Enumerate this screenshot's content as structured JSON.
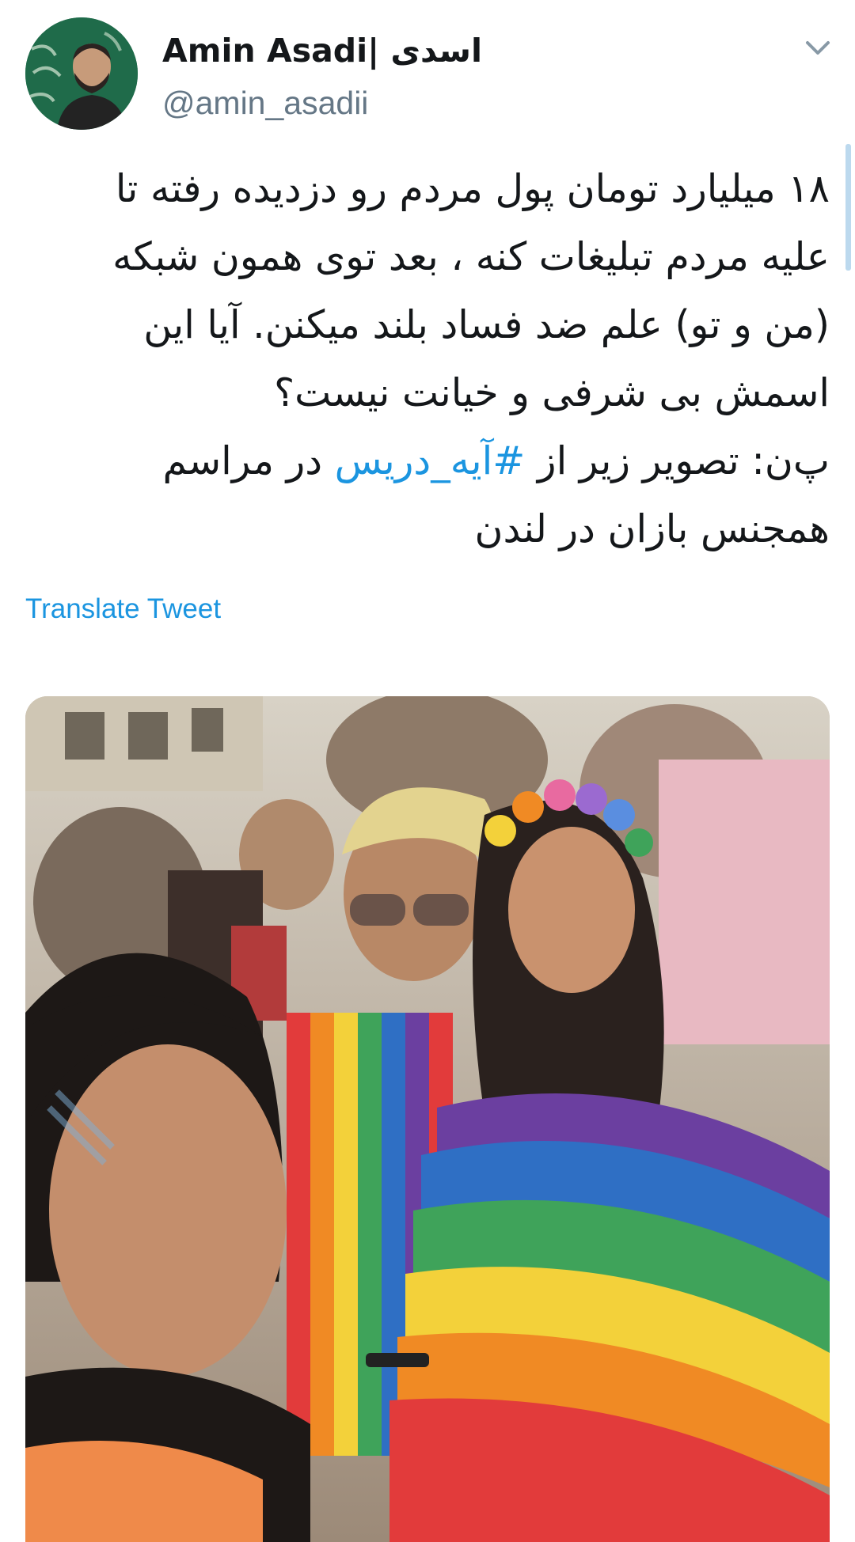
{
  "tweet": {
    "author": {
      "display_name": "Amin Asadi| اسدی",
      "handle": "@amin_asadii",
      "avatar_icon": "profile-photo-avatar"
    },
    "menu_icon": "chevron-down-icon",
    "text_lines": [
      "۱۸ میلیارد تومان پول مردم رو دزدیده رفته تا",
      "علیه مردم تبلیغات کنه ، بعد توی همون شبکه",
      "(من و تو) علم ضد فساد بلند میکنن. آیا این",
      "اسمش بی شرفی و خیانت نیست؟"
    ],
    "note_prefix": "پ‌ن: تصویر زیر از",
    "hashtag": "#آیه_دریس",
    "note_suffix": "در مراسم",
    "last_line": "همجنس بازان در لندن",
    "translate_label": "Translate Tweet",
    "media": {
      "description_icon": "photo-media",
      "rainbow_colors": [
        "#e23b3b",
        "#f08a24",
        "#f3d13a",
        "#3fa35a",
        "#2f6fc4",
        "#6b3fa0"
      ]
    },
    "colors": {
      "link": "#1b95e0",
      "secondary_text": "#657786",
      "thread_marker": "#bcd9ee"
    }
  }
}
